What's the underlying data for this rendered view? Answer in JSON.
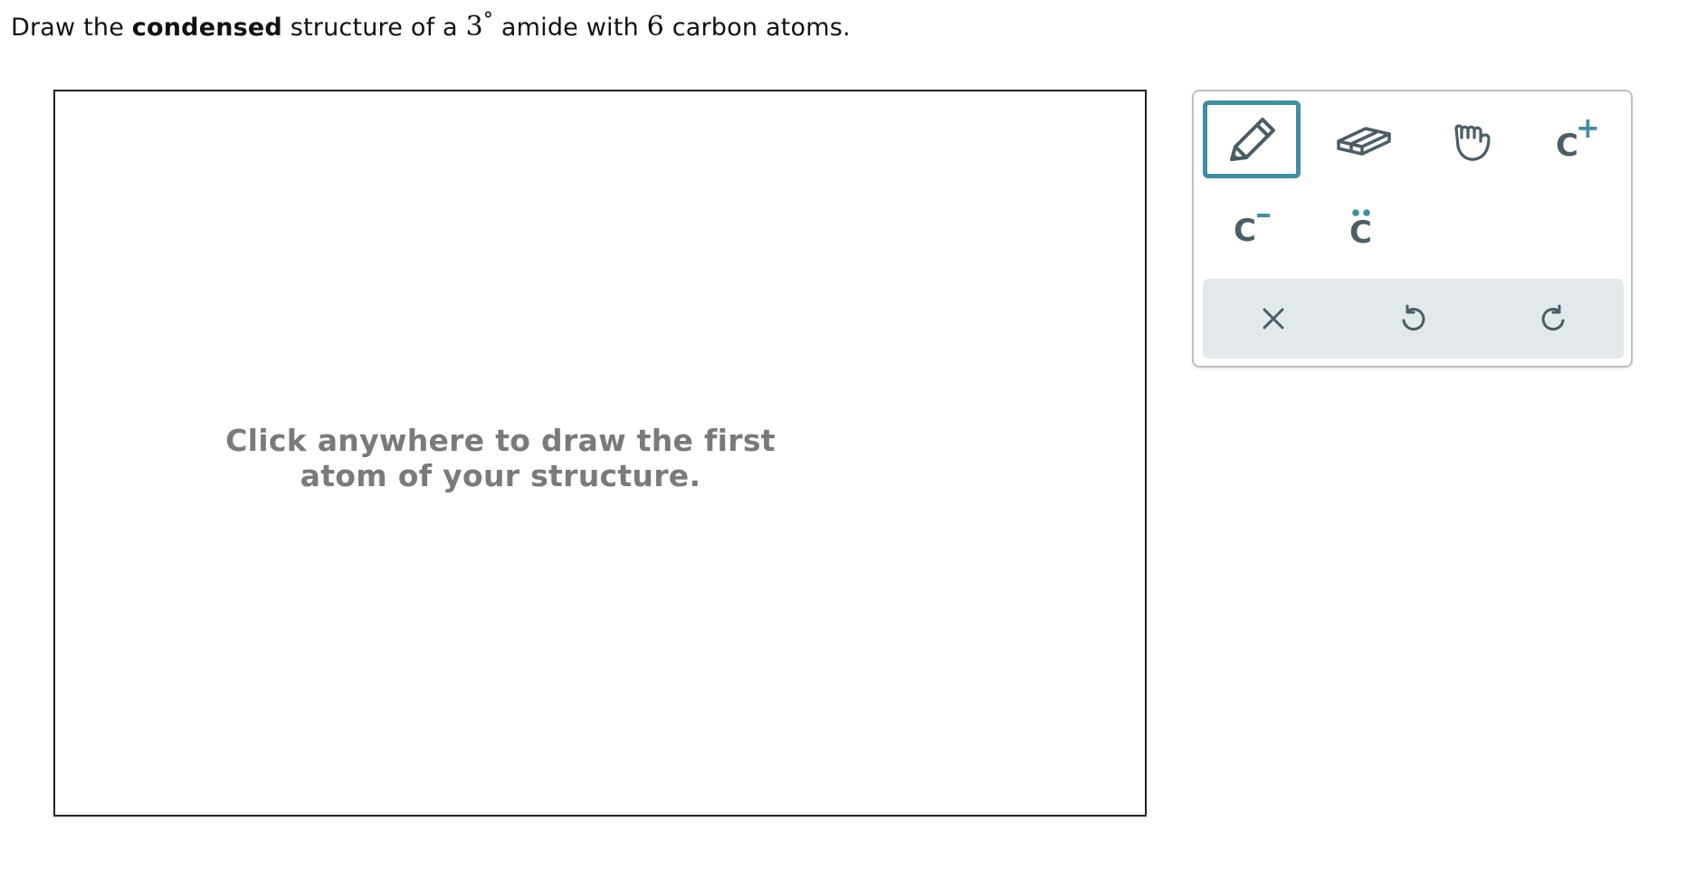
{
  "prompt": {
    "part1": "Draw the ",
    "bold": "condensed",
    "part2": " structure of a ",
    "degree_number": "3",
    "degree_symbol": "°",
    "part3": " amide with ",
    "carbon_count": "6",
    "part4": " carbon atoms."
  },
  "canvas": {
    "hint_line1": "Click anywhere to draw the first",
    "hint_line2": "atom of your structure."
  },
  "toolbox": {
    "tools": [
      {
        "name": "pencil-tool",
        "icon": "pencil-icon",
        "selected": true
      },
      {
        "name": "eraser-tool",
        "icon": "eraser-icon",
        "selected": false
      },
      {
        "name": "move-tool",
        "icon": "hand-icon",
        "selected": false
      },
      {
        "name": "positive-charge-tool",
        "icon": "positive-charge-icon",
        "label": "C",
        "charge": "+",
        "selected": false
      },
      {
        "name": "negative-charge-tool",
        "icon": "negative-charge-icon",
        "label": "C",
        "charge": "−",
        "selected": false
      },
      {
        "name": "lone-pair-tool",
        "icon": "lone-pair-icon",
        "label": "C",
        "selected": false
      }
    ],
    "actions": [
      {
        "name": "clear-button",
        "icon": "close-icon"
      },
      {
        "name": "undo-button",
        "icon": "undo-icon"
      },
      {
        "name": "redo-button",
        "icon": "redo-icon"
      }
    ]
  },
  "colors": {
    "accent": "#3f8ea2",
    "icon": "#4b5d66",
    "charge": "#3f8ea2",
    "action_bar": "#e3e8ea",
    "hint_text": "#7a7a7a"
  }
}
